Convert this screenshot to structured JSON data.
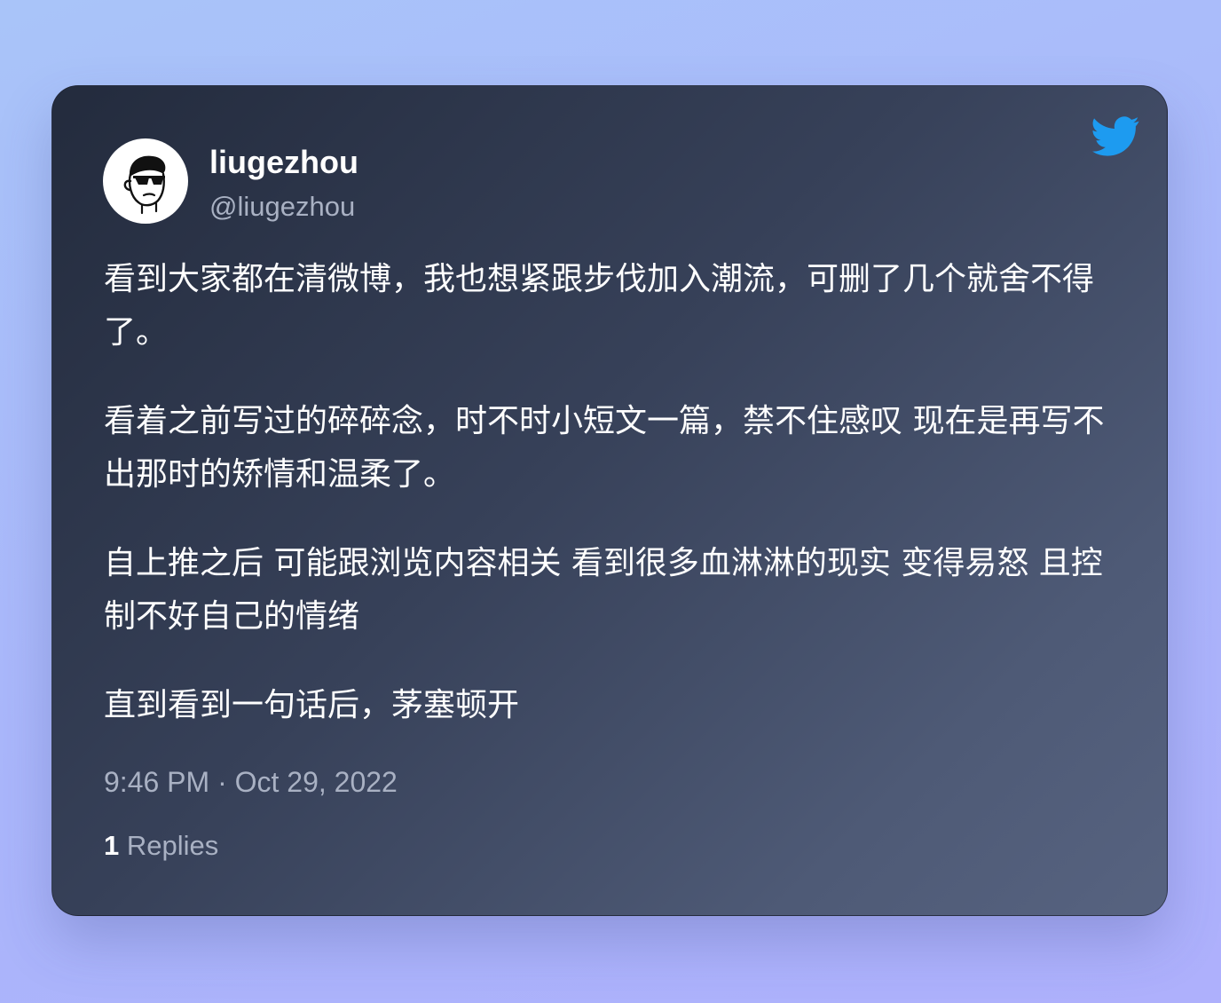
{
  "colors": {
    "accent_bird": "#1d9bf0",
    "card_background": "#374159",
    "text_primary": "#ffffff",
    "text_secondary": "#a9b1c3"
  },
  "icons": {
    "brand": "twitter-bird-icon",
    "avatar": "cartoon-face-with-sunglasses"
  },
  "author": {
    "name": "liugezhou",
    "handle": "@liugezhou"
  },
  "tweet": {
    "paragraphs": [
      "看到大家都在清微博，我也想紧跟步伐加入潮流，可删了几个就舍不得了。",
      "看着之前写过的碎碎念，时不时小短文一篇，禁不住感叹 现在是再写不出那时的矫情和温柔了。",
      "自上推之后 可能跟浏览内容相关 看到很多血淋淋的现实 变得易怒 且控制不好自己的情绪",
      "直到看到一句话后，茅塞顿开"
    ],
    "timestamp": "9:46 PM · Oct 29, 2022",
    "replies_count": "1",
    "replies_label": "Replies"
  }
}
